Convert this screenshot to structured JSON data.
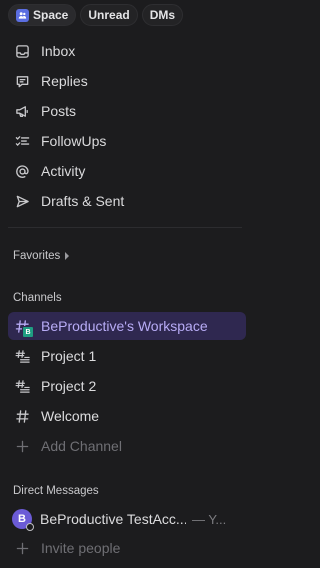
{
  "chips": {
    "space_label": "Space",
    "unread_label": "Unread",
    "dms_label": "DMs"
  },
  "nav": {
    "inbox": "Inbox",
    "replies": "Replies",
    "posts": "Posts",
    "followups": "FollowUps",
    "activity": "Activity",
    "drafts": "Drafts & Sent"
  },
  "favorites": {
    "label": "Favorites"
  },
  "channels": {
    "header": "Channels",
    "items": [
      {
        "label": "BeProductive's Workspace",
        "icon": "space-channel-icon",
        "badge": "B"
      },
      {
        "label": "Project 1",
        "icon": "thread-channel-icon"
      },
      {
        "label": "Project 2",
        "icon": "thread-channel-icon"
      },
      {
        "label": "Welcome",
        "icon": "hash-icon"
      }
    ],
    "add_label": "Add Channel"
  },
  "direct_messages": {
    "header": "Direct Messages",
    "item": {
      "avatar_initial": "B",
      "name": "BeProductive TestAcc...",
      "suffix": "— Y..."
    },
    "invite_label": "Invite people"
  },
  "colors": {
    "background": "#1c1c1e",
    "selected_bg": "#2f2850",
    "selected_text": "#b8acf6",
    "avatar": "#6b5bd6",
    "badge": "#1f9e82"
  }
}
